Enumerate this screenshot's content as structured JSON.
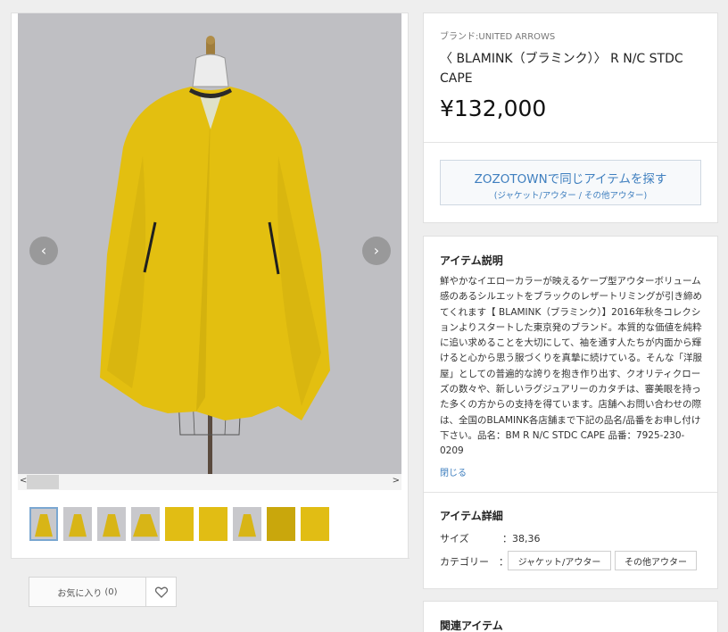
{
  "gallery": {
    "prev_arrow": "‹",
    "next_arrow": "›",
    "scroll_left": "<",
    "scroll_right": ">",
    "thumbnail_count": 9,
    "active_thumbnail": 1
  },
  "favorite": {
    "label": "お気に入り",
    "count": "(0)"
  },
  "product": {
    "brand": "ブランド:UNITED ARROWS",
    "title": "〈 BLAMINK（ブラミンク）〉 R N/C STDC CAPE",
    "price": "¥132,000"
  },
  "zozo": {
    "main_label": "ZOZOTOWNで同じアイテムを探す",
    "sub_label": "(ジャケット/アウター / その他アウター)"
  },
  "description": {
    "heading": "アイテム説明",
    "text": "鮮やかなイエローカラーが映えるケープ型アウターボリューム感のあるシルエットをブラックのレザートリミングが引き締めてくれます【 BLAMINK（ブラミンク）】2016年秋冬コレクションよりスタートした東京発のブランド。本質的な価値を純粋に追い求めることを大切にして、袖を通す人たちが内面から輝けると心から思う服づくりを真摯に続けている。そんな「洋服屋」としての普遍的な誇りを抱き作り出す、クオリティクローズの数々や、新しいラグジュアリーのカタチは、審美眼を持った多くの方からの支持を得ています。店舗へお問い合わせの際は、全国のBLAMINK各店舗まで下記の品名/品番をお申し付け下さい。品名：BM R N/C STDC CAPE 品番：7925-230-0209",
    "close_link": "閉じる"
  },
  "details": {
    "heading": "アイテム詳細",
    "size_label": "サイズ",
    "size_value": "：38,36",
    "category_label": "カテゴリー",
    "category_colon": "：",
    "categories": [
      "ジャケット/アウター",
      "その他アウター"
    ]
  },
  "related": {
    "heading": "関連アイテム"
  },
  "colors": {
    "accent": "#3f7fbf",
    "cape_yellow": "#e3bf10",
    "image_bg": "#bfbfc3"
  }
}
